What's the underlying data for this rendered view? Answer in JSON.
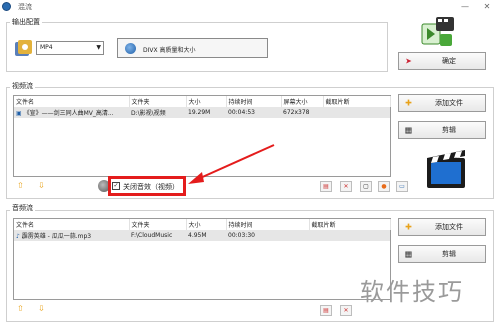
{
  "window": {
    "title": "混流",
    "minimize": "—",
    "close": "✕"
  },
  "output": {
    "group_label": "输出配置",
    "format": "MP4",
    "profile": "DIVX 高质量和大小",
    "confirm_label": "确定"
  },
  "video": {
    "group_label": "视频流",
    "columns": [
      "文件名",
      "文件夹",
      "大小",
      "持续时间",
      "屏幕大小",
      "截取片断"
    ],
    "rows": [
      {
        "name": "《宣》——剑三同人曲MV_高清...",
        "folder": "D:\\影视\\视频",
        "size": "19.29M",
        "duration": "00:04:53",
        "screen": "672x378",
        "clip": ""
      }
    ],
    "add_label": "添加文件",
    "edit_label": "剪辑",
    "mute_label": "关闭音效（视频）",
    "mute_checked": true
  },
  "audio": {
    "group_label": "音频流",
    "columns": [
      "文件名",
      "文件夹",
      "大小",
      "持续时间",
      "截取片断"
    ],
    "rows": [
      {
        "name": "霹雳英雄 - 瓜瓜一蒜.mp3",
        "folder": "F:\\CloudMusic",
        "size": "4.95M",
        "duration": "00:03:30",
        "clip": ""
      }
    ],
    "add_label": "添加文件",
    "edit_label": "剪辑"
  },
  "watermark": "软件技巧",
  "colors": {
    "highlight": "#e41c1c",
    "accent_blue": "#1f5fa8",
    "toolbar_icon": "#e8a21a"
  }
}
